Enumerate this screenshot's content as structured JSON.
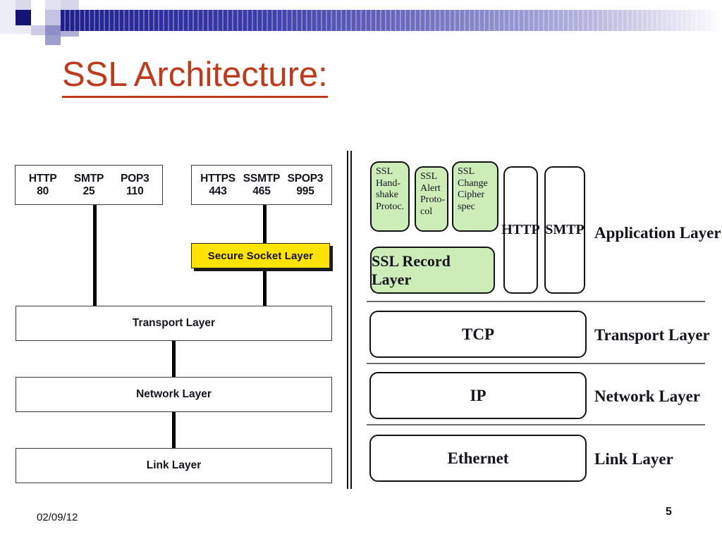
{
  "slide": {
    "title": "SSL Architecture:",
    "date": "02/09/12",
    "page_number": "5",
    "accent_color": "#c0391b",
    "header_bar_color": "#1f1f8c",
    "ssl_highlight_color": "#ffe400",
    "ssl_green_color": "#cdedb8"
  },
  "left_diagram": {
    "plain_ports": {
      "names": [
        "HTTP",
        "SMTP",
        "POP3"
      ],
      "ports": [
        "80",
        "25",
        "110"
      ]
    },
    "secure_ports": {
      "names": [
        "HTTPS",
        "SSMTP",
        "SPOP3"
      ],
      "ports": [
        "443",
        "465",
        "995"
      ]
    },
    "ssl_box_label": "Secure Socket Layer",
    "stack": [
      {
        "label": "Transport Layer"
      },
      {
        "label": "Network Layer"
      },
      {
        "label": "Link Layer"
      }
    ]
  },
  "right_diagram": {
    "application_layer": {
      "label": "Application Layer",
      "ssl_protocols": [
        {
          "label": "SSL Hand- shake Protoc."
        },
        {
          "label": "SSL Alert Proto- col"
        },
        {
          "label": "SSL Change Cipher spec"
        }
      ],
      "record_layer": "SSL Record Layer",
      "apps": [
        "HTTP",
        "SMTP"
      ]
    },
    "layers": [
      {
        "protocol": "TCP",
        "label": "Transport Layer"
      },
      {
        "protocol": "IP",
        "label": "Network Layer"
      },
      {
        "protocol": "Ethernet",
        "label": "Link Layer"
      }
    ]
  }
}
